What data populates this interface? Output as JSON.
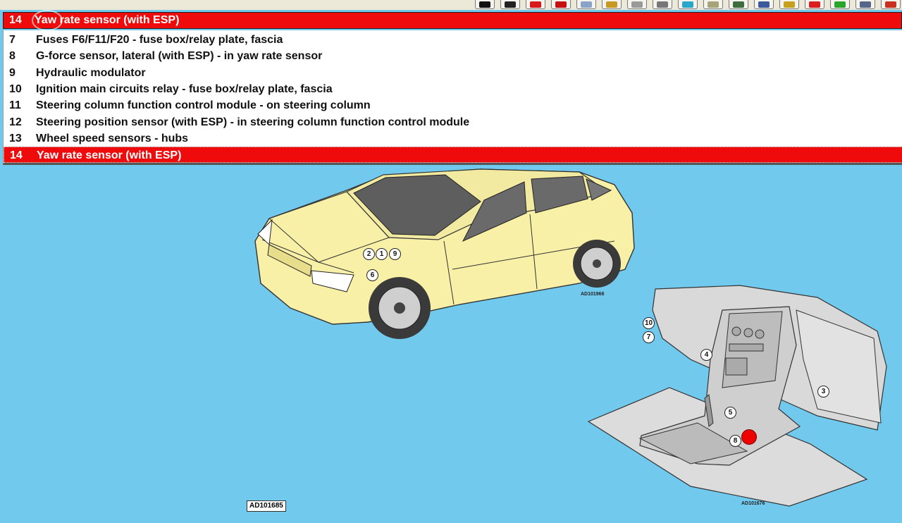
{
  "toolbar": {
    "buttons": [
      {
        "name": "bold-n-icon",
        "color": "#111111"
      },
      {
        "name": "back-arrow-icon",
        "color": "#222222"
      },
      {
        "name": "warning-icon",
        "color": "#d81818"
      },
      {
        "name": "flag-icon",
        "color": "#c41010"
      },
      {
        "name": "mail-icon",
        "color": "#8aa4c8"
      },
      {
        "name": "settings-icon",
        "color": "#c69a22"
      },
      {
        "name": "wrench-icon",
        "color": "#9a9a9a"
      },
      {
        "name": "circle-icon",
        "color": "#777777"
      },
      {
        "name": "search-icon",
        "color": "#2aa6c8"
      },
      {
        "name": "document-icon",
        "color": "#a8a47a"
      },
      {
        "name": "save-icon",
        "color": "#3e6e3e"
      },
      {
        "name": "network-icon",
        "color": "#3a5a9a"
      },
      {
        "name": "check-icon",
        "color": "#c8a020"
      },
      {
        "name": "alert-icon",
        "color": "#d82020"
      },
      {
        "name": "monitor-icon",
        "color": "#2aa42a"
      },
      {
        "name": "tools-icon",
        "color": "#556688"
      },
      {
        "name": "key-icon",
        "color": "#c83020"
      }
    ]
  },
  "combo": {
    "number": "14",
    "text": "Yaw rate sensor (with ESP)"
  },
  "list": {
    "items": [
      {
        "number": "7",
        "text": "Fuses F6/F11/F20 - fuse box/relay plate, fascia",
        "selected": false
      },
      {
        "number": "8",
        "text": "G-force sensor, lateral (with ESP) - in yaw rate sensor",
        "selected": false
      },
      {
        "number": "9",
        "text": "Hydraulic modulator",
        "selected": false
      },
      {
        "number": "10",
        "text": "Ignition main circuits relay - fuse box/relay plate, fascia",
        "selected": false
      },
      {
        "number": "11",
        "text": "Steering column function control module - on steering column",
        "selected": false
      },
      {
        "number": "12",
        "text": "Steering position sensor (with ESP) - in steering column function control module",
        "selected": false
      },
      {
        "number": "13",
        "text": "Wheel speed sensors - hubs",
        "selected": false
      },
      {
        "number": "14",
        "text": "Yaw rate sensor (with ESP)",
        "selected": true
      }
    ]
  },
  "diagram": {
    "car_code": "AD101966",
    "dash_code": "AD101676",
    "main_code": "AD101685",
    "callouts": {
      "c2": "2",
      "c1": "1",
      "c9": "9",
      "c6": "6",
      "c10": "10",
      "c7": "7",
      "c4": "4",
      "c3": "3",
      "c5": "5",
      "c8": "8"
    }
  }
}
